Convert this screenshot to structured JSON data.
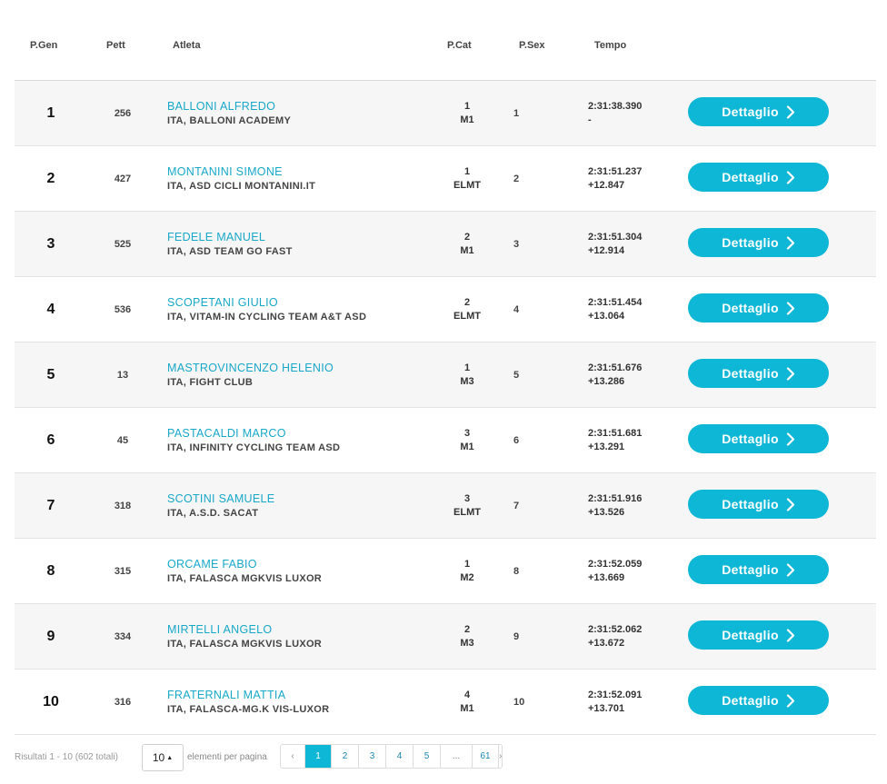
{
  "columns": {
    "gen": "P.Gen",
    "pett": "Pett",
    "atleta": "Atleta",
    "cat": "P.Cat",
    "sex": "P.Sex",
    "tempo": "Tempo"
  },
  "button_label": "Dettaglio",
  "rows": [
    {
      "pos": "1",
      "pett": "256",
      "name": "BALLONI ALFREDO",
      "team": "ITA, BALLONI ACADEMY",
      "cat_pos": "1",
      "cat": "M1",
      "sex": "1",
      "time": "2:31:38.390",
      "gap": "-"
    },
    {
      "pos": "2",
      "pett": "427",
      "name": "MONTANINI SIMONE",
      "team": "ITA, ASD CICLI MONTANINI.IT",
      "cat_pos": "1",
      "cat": "ELMT",
      "sex": "2",
      "time": "2:31:51.237",
      "gap": "+12.847"
    },
    {
      "pos": "3",
      "pett": "525",
      "name": "FEDELE MANUEL",
      "team": "ITA, ASD TEAM GO FAST",
      "cat_pos": "2",
      "cat": "M1",
      "sex": "3",
      "time": "2:31:51.304",
      "gap": "+12.914"
    },
    {
      "pos": "4",
      "pett": "536",
      "name": "SCOPETANI GIULIO",
      "team": "ITA, VITAM-IN CYCLING TEAM A&T ASD",
      "cat_pos": "2",
      "cat": "ELMT",
      "sex": "4",
      "time": "2:31:51.454",
      "gap": "+13.064"
    },
    {
      "pos": "5",
      "pett": "13",
      "name": "MASTROVINCENZO HELENIO",
      "team": "ITA, FIGHT CLUB",
      "cat_pos": "1",
      "cat": "M3",
      "sex": "5",
      "time": "2:31:51.676",
      "gap": "+13.286"
    },
    {
      "pos": "6",
      "pett": "45",
      "name": "PASTACALDI MARCO",
      "team": "ITA, INFINITY CYCLING TEAM ASD",
      "cat_pos": "3",
      "cat": "M1",
      "sex": "6",
      "time": "2:31:51.681",
      "gap": "+13.291"
    },
    {
      "pos": "7",
      "pett": "318",
      "name": "SCOTINI SAMUELE",
      "team": "ITA, A.S.D. SACAT",
      "cat_pos": "3",
      "cat": "ELMT",
      "sex": "7",
      "time": "2:31:51.916",
      "gap": "+13.526"
    },
    {
      "pos": "8",
      "pett": "315",
      "name": "ORCAME FABIO",
      "team": "ITA, FALASCA MGKVIS LUXOR",
      "cat_pos": "1",
      "cat": "M2",
      "sex": "8",
      "time": "2:31:52.059",
      "gap": "+13.669"
    },
    {
      "pos": "9",
      "pett": "334",
      "name": "MIRTELLI ANGELO",
      "team": "ITA, FALASCA MGKVIS LUXOR",
      "cat_pos": "2",
      "cat": "M3",
      "sex": "9",
      "time": "2:31:52.062",
      "gap": "+13.672"
    },
    {
      "pos": "10",
      "pett": "316",
      "name": "FRATERNALI MATTIA",
      "team": "ITA, FALASCA-MG.K VIS-LUXOR",
      "cat_pos": "4",
      "cat": "M1",
      "sex": "10",
      "time": "2:31:52.091",
      "gap": "+13.701"
    }
  ],
  "pagination": {
    "results_text": "Risultati 1 - 10 (602 totali)",
    "page_size": "10",
    "per_page_label": "elementi per pagina",
    "prev": "‹",
    "next": "›",
    "pages": [
      "1",
      "2",
      "3",
      "4",
      "5",
      "...",
      "61"
    ],
    "active_page": "1"
  },
  "colors": {
    "accent": "#0fb7d6",
    "name_link": "#17a8c9",
    "row_alt": "#f6f6f6"
  },
  "icons": {
    "button_icon": "chevron-right-icon",
    "select_icon": "caret-up-icon"
  }
}
